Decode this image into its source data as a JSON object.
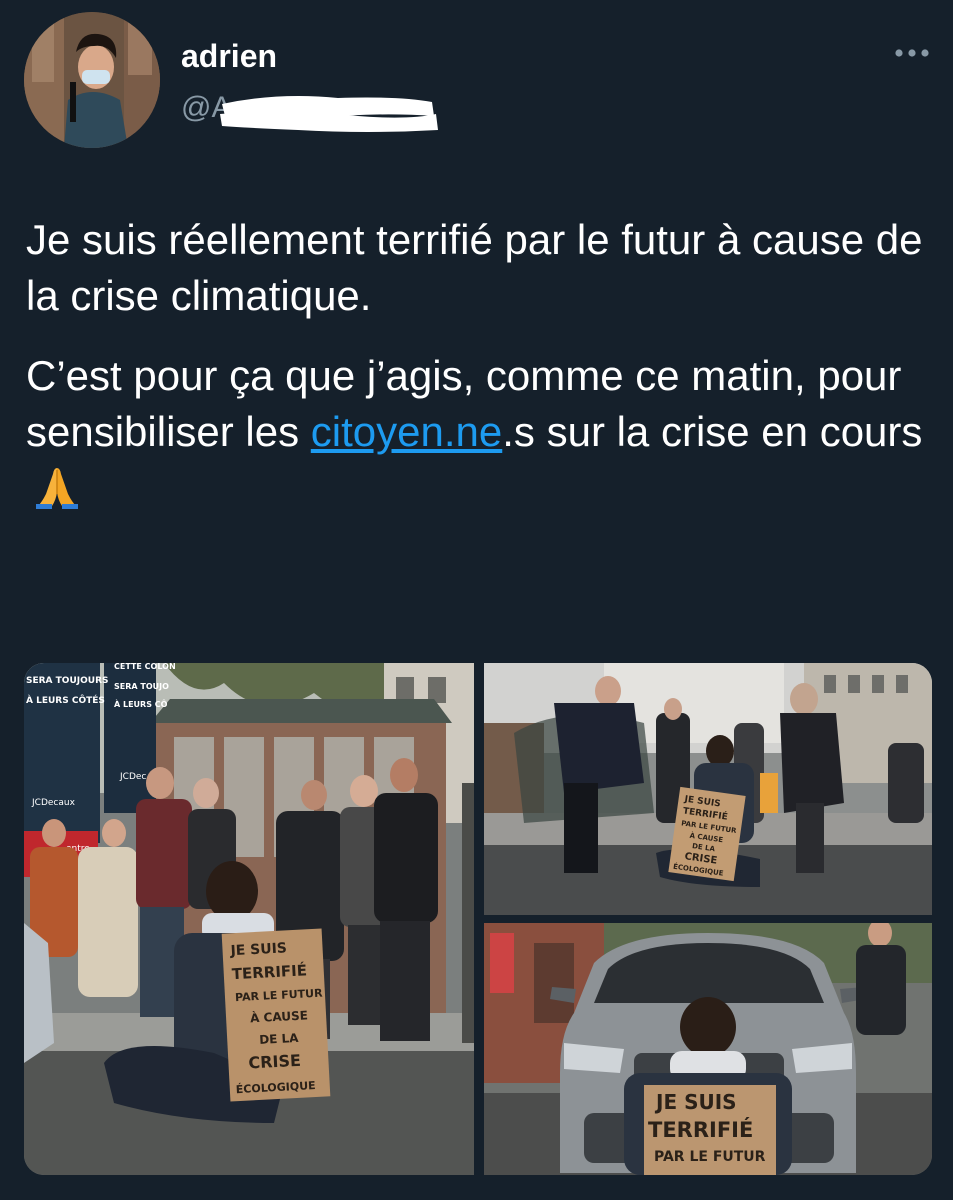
{
  "tweet": {
    "author": {
      "display_name": "adrien",
      "handle_prefix": "@A"
    },
    "text_paragraph_1": "Je suis réellement terrifié par le futur à cause de la crise climatique.",
    "text_paragraph_2_part1": "C’est pour ça que j’agis, comme ce matin, pour sensibiliser les ",
    "text_paragraph_2_link": "citoyen.ne",
    "text_paragraph_2_part2": ".s sur la crise en cours",
    "emoji": "folded-hands",
    "colors": {
      "background": "#15202b",
      "text": "#ffffff",
      "secondary_text": "#8899a6",
      "link": "#1d9bf0"
    }
  },
  "media": {
    "photo_1": {
      "sign_lines": [
        "JE SUIS",
        "TERRIFIÉ",
        "PAR LE FUTUR",
        "À CAUSE",
        "DE LA",
        "CRISE",
        "ÉCOLOGIQUE"
      ],
      "billboard_lines_1": [
        "SERA TOUJOURS",
        "À LEURS CÔTÉS"
      ],
      "billboard_lines_2": [
        "CETTE COLON",
        "SERA TOUJO",
        "À LEURS CÔ"
      ],
      "billboard_brand": "JCDecaux",
      "billboard_brand_2": "JCDec",
      "red_poster_lines": [
        "entre",
        "ourci"
      ]
    },
    "photo_2": {
      "sign_lines": [
        "JE SUIS",
        "TERRIFIÉ",
        "PAR LE FUTUR",
        "À CAUSE",
        "DE LA",
        "CRISE",
        "ÉCOLOGIQUE"
      ]
    },
    "photo_3": {
      "sign_lines": [
        "JE SUIS",
        "TERRIFIÉ",
        "PAR LE FUTUR"
      ]
    }
  }
}
